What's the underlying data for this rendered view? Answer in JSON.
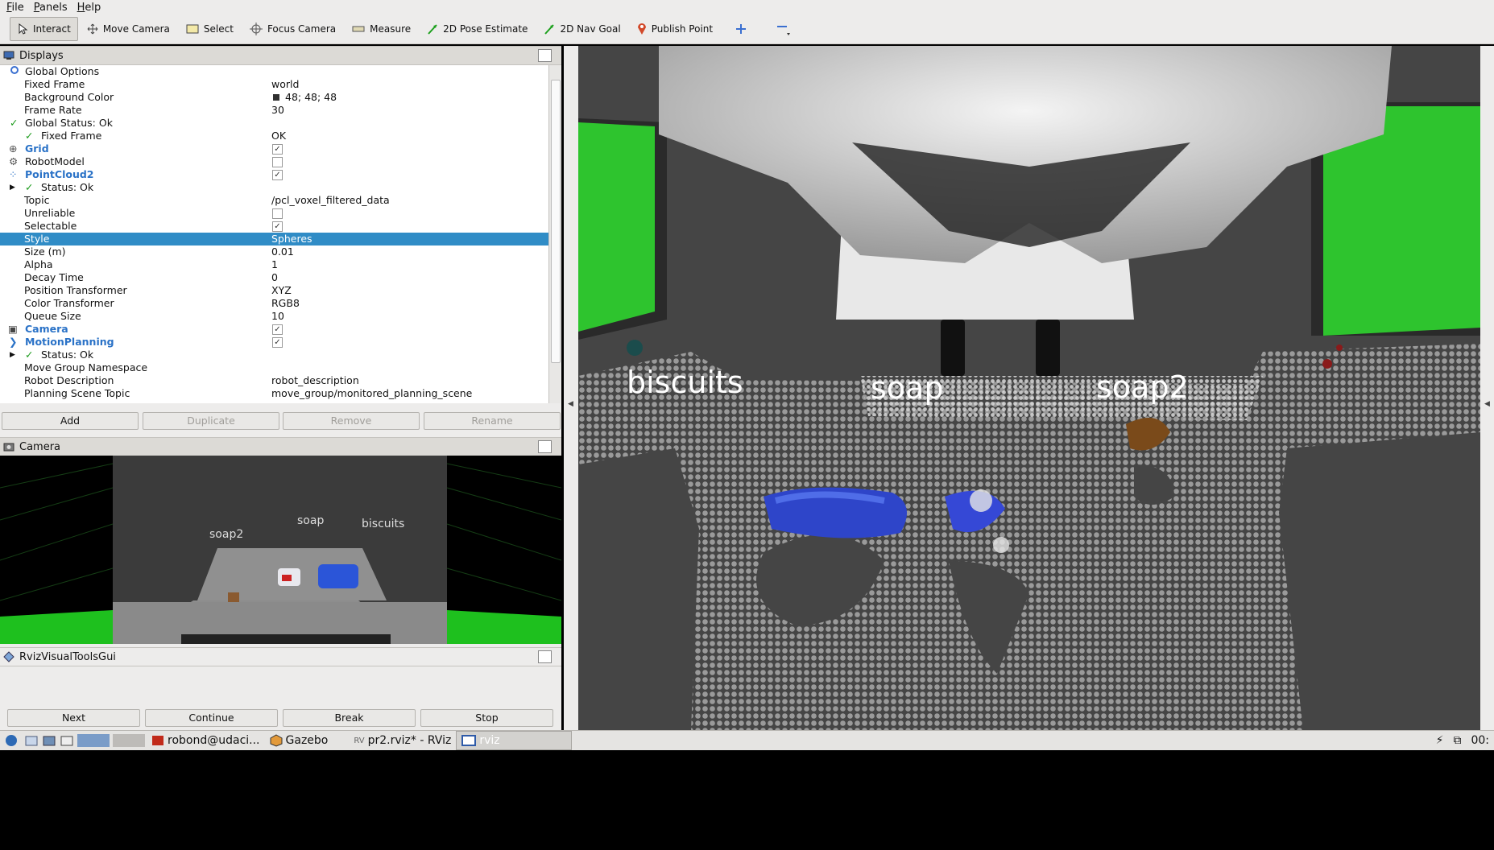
{
  "menu": [
    "File",
    "Panels",
    "Help"
  ],
  "toolbar": {
    "tools": [
      {
        "label": "Interact",
        "icon": "cursor-icon"
      },
      {
        "label": "Move Camera",
        "icon": "move-icon"
      },
      {
        "label": "Select",
        "icon": "select-box-icon"
      },
      {
        "label": "Focus Camera",
        "icon": "crosshair-icon"
      },
      {
        "label": "Measure",
        "icon": "ruler-icon"
      },
      {
        "label": "2D Pose Estimate",
        "icon": "green-arrow-icon"
      },
      {
        "label": "2D Nav Goal",
        "icon": "green-arrow-icon"
      },
      {
        "label": "Publish Point",
        "icon": "pin-icon"
      }
    ]
  },
  "displays": {
    "title": "Displays",
    "rows": [
      {
        "name": "Global Options",
        "value": "",
        "indent": 0
      },
      {
        "name": "Fixed Frame",
        "value": "world",
        "indent": 1
      },
      {
        "name": "Background Color",
        "value": "48; 48; 48",
        "indent": 1
      },
      {
        "name": "Frame Rate",
        "value": "30",
        "indent": 1
      },
      {
        "name": "Global Status: Ok",
        "value": "",
        "indent": 0
      },
      {
        "name": "Fixed Frame",
        "value": "OK",
        "indent": 2
      },
      {
        "name": "Grid",
        "value": "",
        "indent": 0
      },
      {
        "name": "RobotModel",
        "value": "",
        "indent": 0
      },
      {
        "name": "PointCloud2",
        "value": "",
        "indent": 0
      },
      {
        "name": "Status: Ok",
        "value": "",
        "indent": 2
      },
      {
        "name": "Topic",
        "value": "/pcl_voxel_filtered_data",
        "indent": 1
      },
      {
        "name": "Unreliable",
        "value": "",
        "indent": 1
      },
      {
        "name": "Selectable",
        "value": "",
        "indent": 1
      },
      {
        "name": "Style",
        "value": "Spheres",
        "indent": 1
      },
      {
        "name": "Size (m)",
        "value": "0.01",
        "indent": 1
      },
      {
        "name": "Alpha",
        "value": "1",
        "indent": 1
      },
      {
        "name": "Decay Time",
        "value": "0",
        "indent": 1
      },
      {
        "name": "Position Transformer",
        "value": "XYZ",
        "indent": 1
      },
      {
        "name": "Color Transformer",
        "value": "RGB8",
        "indent": 1
      },
      {
        "name": "Queue Size",
        "value": "10",
        "indent": 1
      },
      {
        "name": "Camera",
        "value": "",
        "indent": 0
      },
      {
        "name": "MotionPlanning",
        "value": "",
        "indent": 0
      },
      {
        "name": "Status: Ok",
        "value": "",
        "indent": 2
      },
      {
        "name": "Move Group Namespace",
        "value": "",
        "indent": 1
      },
      {
        "name": "Robot Description",
        "value": "robot_description",
        "indent": 1
      },
      {
        "name": "Planning Scene Topic",
        "value": "move_group/monitored_planning_scene",
        "indent": 1
      }
    ],
    "buttons": [
      "Add",
      "Duplicate",
      "Remove",
      "Rename"
    ]
  },
  "camera_panel": {
    "title": "Camera",
    "labels": [
      "soap2",
      "soap",
      "biscuits"
    ]
  },
  "rviz_tools": {
    "title": "RvizVisualToolsGui",
    "buttons": [
      "Next",
      "Continue",
      "Break",
      "Stop"
    ]
  },
  "scene": {
    "labels": [
      "biscuits",
      "soap",
      "soap2"
    ]
  },
  "taskbar": {
    "items": [
      "robond@udaci...",
      "Gazebo",
      "pr2.rviz* - RViz",
      "rviz"
    ],
    "clock": "00:"
  },
  "colors": {
    "selection": "#308cc6",
    "link_blue": "#2a72c7",
    "ok_green": "#1a9a1a",
    "viewport_bg": "#454545"
  }
}
